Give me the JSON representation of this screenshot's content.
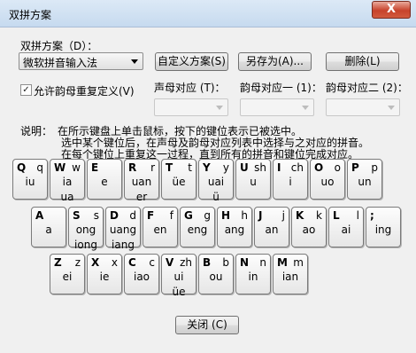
{
  "window": {
    "title": "双拼方案",
    "close_glyph": "X"
  },
  "scheme": {
    "label": "双拼方案（D）：",
    "selected": "微软拼音输入法"
  },
  "buttons": {
    "custom": "自定义方案(S)",
    "save_as": "另存为(A)...",
    "delete": "删除(L)",
    "close": "关闭 (C)"
  },
  "options": {
    "allow_repeat_label": "允许韵母重复定义(V)",
    "allow_repeat_checked": true,
    "shengmu_label": "声母对应 (T)：",
    "yunmu1_label": "韵母对应一 (1)：",
    "yunmu2_label": "韵母对应二 (2)："
  },
  "instructions": {
    "prefix": "说明：",
    "line1": "在所示键盘上单击鼠标，按下的键位表示已被选中。",
    "line2": "选中某个键位后，在声母及韵母对应列表中选择与之对应的拼音。",
    "line3": "在每个键位上重复这一过程，直到所有的拼音和键位完成对应。"
  },
  "keyboard": {
    "row1": [
      {
        "letter": "Q",
        "sheng": "q",
        "yun": [
          "iu"
        ]
      },
      {
        "letter": "W",
        "sheng": "w",
        "yun": [
          "ia",
          "ua"
        ]
      },
      {
        "letter": "E",
        "sheng": "",
        "yun": [
          "e"
        ]
      },
      {
        "letter": "R",
        "sheng": "r",
        "yun": [
          "uan",
          "er"
        ]
      },
      {
        "letter": "T",
        "sheng": "t",
        "yun": [
          "üe"
        ]
      },
      {
        "letter": "Y",
        "sheng": "y",
        "yun": [
          "uai",
          "ü"
        ]
      },
      {
        "letter": "U",
        "sheng": "sh",
        "yun": [
          "u"
        ]
      },
      {
        "letter": "I",
        "sheng": "ch",
        "yun": [
          "i"
        ]
      },
      {
        "letter": "O",
        "sheng": "o",
        "yun": [
          "uo"
        ]
      },
      {
        "letter": "P",
        "sheng": "p",
        "yun": [
          "un"
        ]
      }
    ],
    "row2": [
      {
        "letter": "A",
        "sheng": "",
        "yun": [
          "a"
        ]
      },
      {
        "letter": "S",
        "sheng": "s",
        "yun": [
          "ong",
          "iong"
        ]
      },
      {
        "letter": "D",
        "sheng": "d",
        "yun": [
          "uang",
          "iang"
        ]
      },
      {
        "letter": "F",
        "sheng": "f",
        "yun": [
          "en"
        ]
      },
      {
        "letter": "G",
        "sheng": "g",
        "yun": [
          "eng"
        ]
      },
      {
        "letter": "H",
        "sheng": "h",
        "yun": [
          "ang"
        ]
      },
      {
        "letter": "J",
        "sheng": "j",
        "yun": [
          "an"
        ]
      },
      {
        "letter": "K",
        "sheng": "k",
        "yun": [
          "ao"
        ]
      },
      {
        "letter": "L",
        "sheng": "l",
        "yun": [
          "ai"
        ]
      },
      {
        "letter": ";",
        "sheng": "",
        "yun": [
          "ing"
        ]
      }
    ],
    "row3": [
      {
        "letter": "Z",
        "sheng": "z",
        "yun": [
          "ei"
        ]
      },
      {
        "letter": "X",
        "sheng": "x",
        "yun": [
          "ie"
        ]
      },
      {
        "letter": "C",
        "sheng": "c",
        "yun": [
          "iao"
        ]
      },
      {
        "letter": "V",
        "sheng": "zh",
        "yun": [
          "ui",
          "üe"
        ]
      },
      {
        "letter": "B",
        "sheng": "b",
        "yun": [
          "ou"
        ]
      },
      {
        "letter": "N",
        "sheng": "n",
        "yun": [
          "in"
        ]
      },
      {
        "letter": "M",
        "sheng": "m",
        "yun": [
          "ian"
        ]
      }
    ]
  }
}
